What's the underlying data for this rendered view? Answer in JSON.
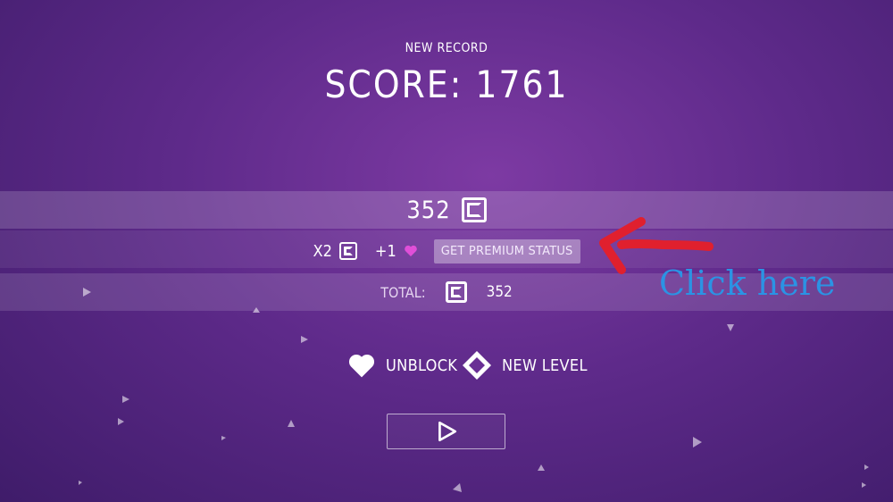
{
  "header": {
    "record_label": "NEW RECORD",
    "score_text": "SCORE: 1761"
  },
  "reward": {
    "coins": "352",
    "multiplier": "X2",
    "lives_bonus": "+1",
    "premium_button": "GET PREMIUM STATUS",
    "total_label": "TOTAL:",
    "total_value": "352"
  },
  "options": {
    "unblock": "UNBLOCK",
    "new_level": "NEW LEVEL"
  },
  "annotation": {
    "text": "Click here",
    "color": "#2b93e4",
    "arrow_color": "#e0202e"
  },
  "icons": [
    "coin-icon",
    "heart-icon",
    "diamond-icon",
    "play-icon",
    "arrow-annotation"
  ]
}
